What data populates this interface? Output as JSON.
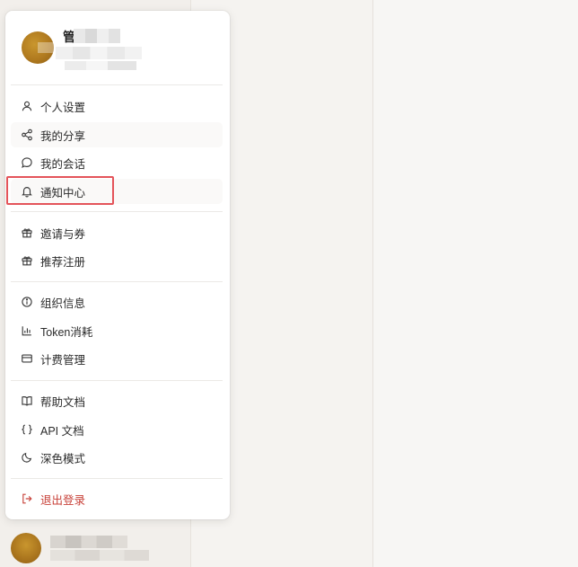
{
  "profile": {
    "name_initial": "管"
  },
  "menu": {
    "group1": [
      {
        "label": "个人设置",
        "icon": "user-icon"
      },
      {
        "label": "我的分享",
        "icon": "share-icon"
      },
      {
        "label": "我的会话",
        "icon": "chat-bubble-icon"
      },
      {
        "label": "通知中心",
        "icon": "bell-icon"
      }
    ],
    "group2": [
      {
        "label": "邀请与券",
        "icon": "gift-icon"
      },
      {
        "label": "推荐注册",
        "icon": "gift-icon"
      }
    ],
    "group3": [
      {
        "label": "组织信息",
        "icon": "info-icon"
      },
      {
        "label": "Token消耗",
        "icon": "bar-chart-icon"
      },
      {
        "label": "计费管理",
        "icon": "credit-card-icon"
      }
    ],
    "group4": [
      {
        "label": "帮助文档",
        "icon": "book-icon"
      },
      {
        "label": "API 文档",
        "icon": "braces-icon"
      },
      {
        "label": "深色模式",
        "icon": "moon-icon"
      }
    ],
    "group5": [
      {
        "label": "退出登录",
        "icon": "logout-icon"
      }
    ]
  },
  "colors": {
    "logout": "#c8423a",
    "highlight": "#e4545a"
  }
}
